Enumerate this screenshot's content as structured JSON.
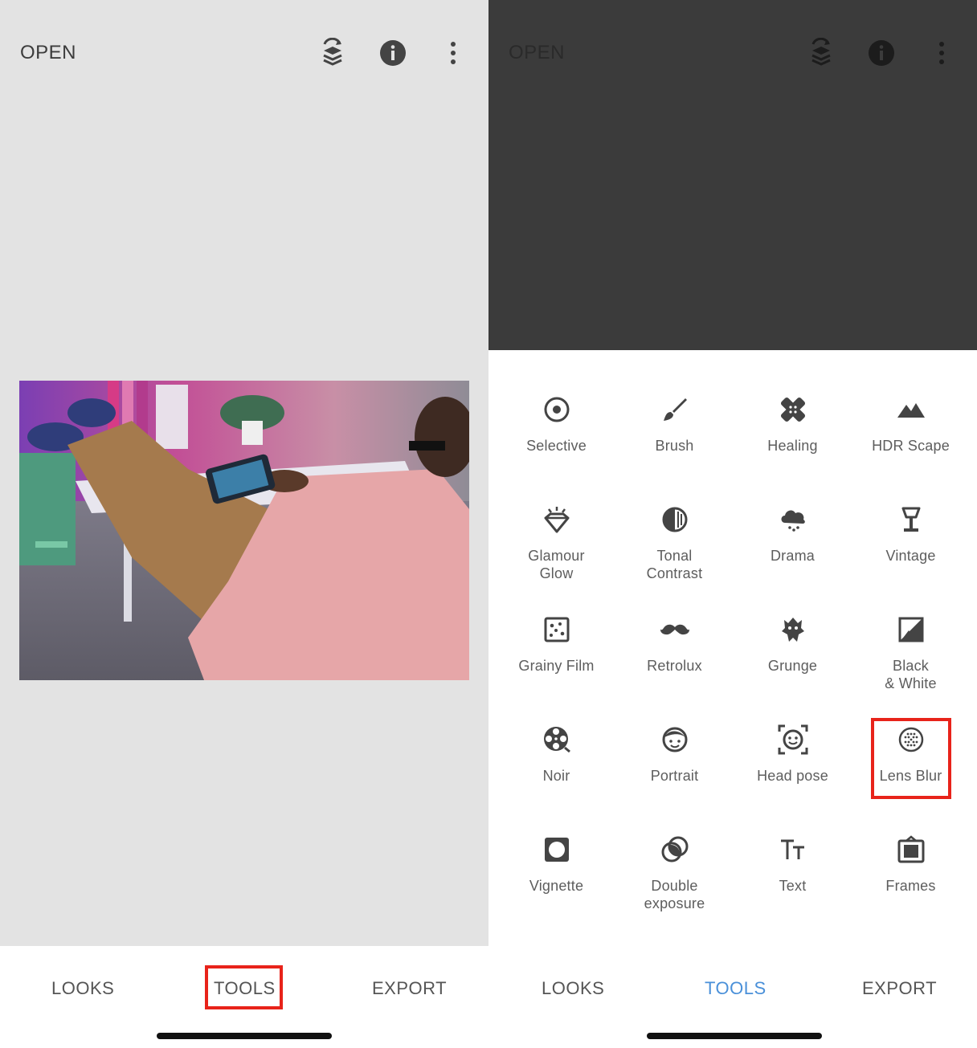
{
  "left": {
    "header": {
      "open_label": "OPEN"
    },
    "nav": {
      "looks": "LOOKS",
      "tools": "TOOLS",
      "export": "EXPORT"
    }
  },
  "right": {
    "header": {
      "open_label": "OPEN"
    },
    "tools": [
      {
        "label": "Selective",
        "icon": "selective-icon"
      },
      {
        "label": "Brush",
        "icon": "brush-icon"
      },
      {
        "label": "Healing",
        "icon": "healing-icon"
      },
      {
        "label": "HDR Scape",
        "icon": "mountain-icon"
      },
      {
        "label": "Glamour\nGlow",
        "icon": "diamond-icon"
      },
      {
        "label": "Tonal\nContrast",
        "icon": "tonal-contrast-icon"
      },
      {
        "label": "Drama",
        "icon": "cloud-icon"
      },
      {
        "label": "Vintage",
        "icon": "lamp-icon"
      },
      {
        "label": "Grainy Film",
        "icon": "grain-icon"
      },
      {
        "label": "Retrolux",
        "icon": "mustache-icon"
      },
      {
        "label": "Grunge",
        "icon": "grunge-icon"
      },
      {
        "label": "Black\n& White",
        "icon": "bw-photo-icon"
      },
      {
        "label": "Noir",
        "icon": "film-reel-icon"
      },
      {
        "label": "Portrait",
        "icon": "face-icon"
      },
      {
        "label": "Head pose",
        "icon": "head-pose-icon"
      },
      {
        "label": "Lens Blur",
        "icon": "lens-blur-icon"
      },
      {
        "label": "Vignette",
        "icon": "vignette-icon"
      },
      {
        "label": "Double\nexposure",
        "icon": "double-exposure-icon"
      },
      {
        "label": "Text",
        "icon": "text-icon"
      },
      {
        "label": "Frames",
        "icon": "frames-icon"
      }
    ],
    "nav": {
      "looks": "LOOKS",
      "tools": "TOOLS",
      "export": "EXPORT"
    }
  },
  "colors": {
    "accent": "#4a90d9",
    "highlight": "#e8231a",
    "left_bg": "#e3e3e3",
    "dark_bg": "#3b3b3b",
    "icon": "#444444"
  }
}
